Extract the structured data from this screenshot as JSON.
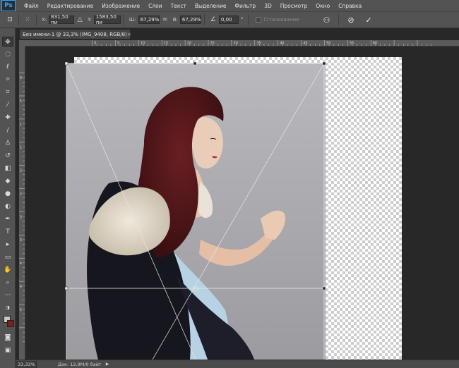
{
  "app": {
    "logo": "Ps"
  },
  "menu": [
    "Файл",
    "Редактирование",
    "Изображение",
    "Слои",
    "Текст",
    "Выделение",
    "Фильтр",
    "3D",
    "Просмотр",
    "Окно",
    "Справка"
  ],
  "options": {
    "x_label": "X:",
    "x_value": "831,50 пи",
    "y_label": "Y:",
    "y_value": "1583,50 пи",
    "w_label": "Ш:",
    "w_value": "67,29%",
    "h_label": "В:",
    "h_value": "67,29%",
    "angle_value": "0,00",
    "angle_unit": "°",
    "smoothing_label": "Сглаживание"
  },
  "document": {
    "tab_title": "Без имени-1 @ 33,3% (IMG_9408, RGB/8)",
    "tab_close": "×"
  },
  "ruler": {
    "top": [
      "0",
      "5",
      "10",
      "15",
      "20",
      "25",
      "30",
      "35",
      "40",
      "45",
      "50",
      "55",
      "60"
    ],
    "left": [
      "0",
      "5",
      "1",
      "1",
      "2",
      "2",
      "3",
      "3",
      "4",
      "4",
      "5"
    ]
  },
  "status": {
    "zoom": "33,33%",
    "doc_info": "Док: 12,9M/0 байт"
  },
  "colors": {
    "foreground": "#c7c7c7",
    "background": "#7a1f1a",
    "accent": "#31a8ff"
  },
  "tools": [
    "move-icon",
    "marquee-icon",
    "lasso-icon",
    "magic-wand-icon",
    "crop-icon",
    "eyedropper-icon",
    "healing-icon",
    "brush-icon",
    "stamp-icon",
    "history-brush-icon",
    "eraser-icon",
    "bucket-icon",
    "blur-icon",
    "dodge-icon",
    "pen-icon",
    "type-icon",
    "path-select-icon",
    "shape-icon",
    "hand-icon",
    "zoom-icon",
    "more-icon"
  ]
}
